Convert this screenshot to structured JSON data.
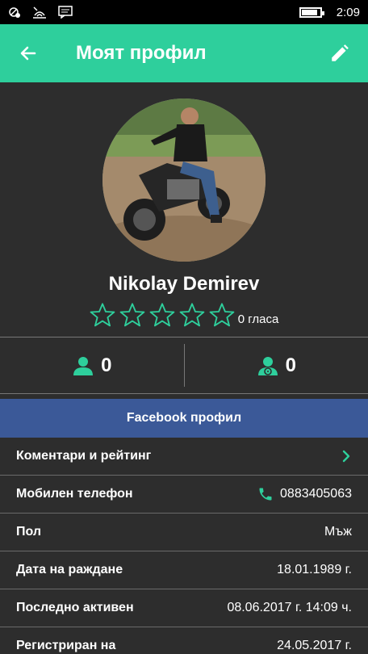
{
  "status_bar": {
    "time": "2:09",
    "battery_level": 0.8,
    "icons": [
      "do-not-disturb-icon",
      "wifi-icon",
      "message-icon",
      "battery-icon"
    ]
  },
  "app_bar": {
    "title": "Моят профил",
    "back_icon": "arrow-left-icon",
    "edit_icon": "pencil-icon"
  },
  "profile": {
    "name": "Nikolay Demirev",
    "rating_stars": 0,
    "rating_max": 5,
    "votes_text": "0 гласа"
  },
  "counters": {
    "passenger_count": "0",
    "driver_count": "0"
  },
  "facebook_button": {
    "label": "Facebook профил"
  },
  "details": {
    "comments": {
      "label": "Коментари и рейтинг"
    },
    "phone": {
      "label": "Мобилен телефон",
      "value": "0883405063"
    },
    "gender": {
      "label": "Пол",
      "value": "Мъж"
    },
    "birthdate": {
      "label": "Дата на раждане",
      "value": "18.01.1989 г."
    },
    "last_active": {
      "label": "Последно активен",
      "value": "08.06.2017 г. 14:09 ч."
    },
    "registered": {
      "label": "Регистриран на",
      "value": "24.05.2017 г."
    }
  },
  "colors": {
    "accent": "#2ecf9c",
    "background": "#2d2d2d",
    "facebook": "#3b5998"
  }
}
